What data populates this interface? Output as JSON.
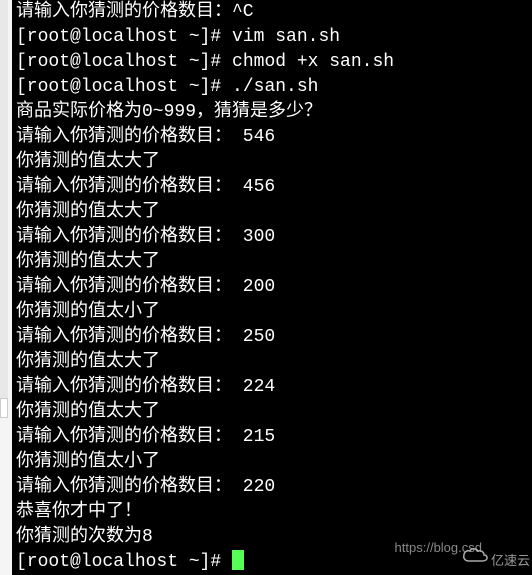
{
  "terminal": {
    "lines": [
      "请输入你猜测的价格数目：^C",
      "[root@localhost ~]# vim san.sh",
      "[root@localhost ~]# chmod +x san.sh",
      "[root@localhost ~]# ./san.sh",
      "商品实际价格为0~999，猜猜是多少？",
      "请输入你猜测的价格数目： 546",
      "你猜测的值太大了",
      "请输入你猜测的价格数目： 456",
      "你猜测的值太大了",
      "请输入你猜测的价格数目： 300",
      "你猜测的值太大了",
      "请输入你猜测的价格数目： 200",
      "你猜测的值太小了",
      "请输入你猜测的价格数目： 250",
      "你猜测的值太大了",
      "请输入你猜测的价格数目： 224",
      "你猜测的值太大了",
      "请输入你猜测的价格数目： 215",
      "你猜测的值太小了",
      "请输入你猜测的价格数目： 220",
      "恭喜你才中了！",
      "你猜测的次数为8"
    ],
    "prompt_last": "[root@localhost ~]# "
  },
  "watermark": {
    "url": "https://blog.csd",
    "logo_text": "亿速云"
  }
}
